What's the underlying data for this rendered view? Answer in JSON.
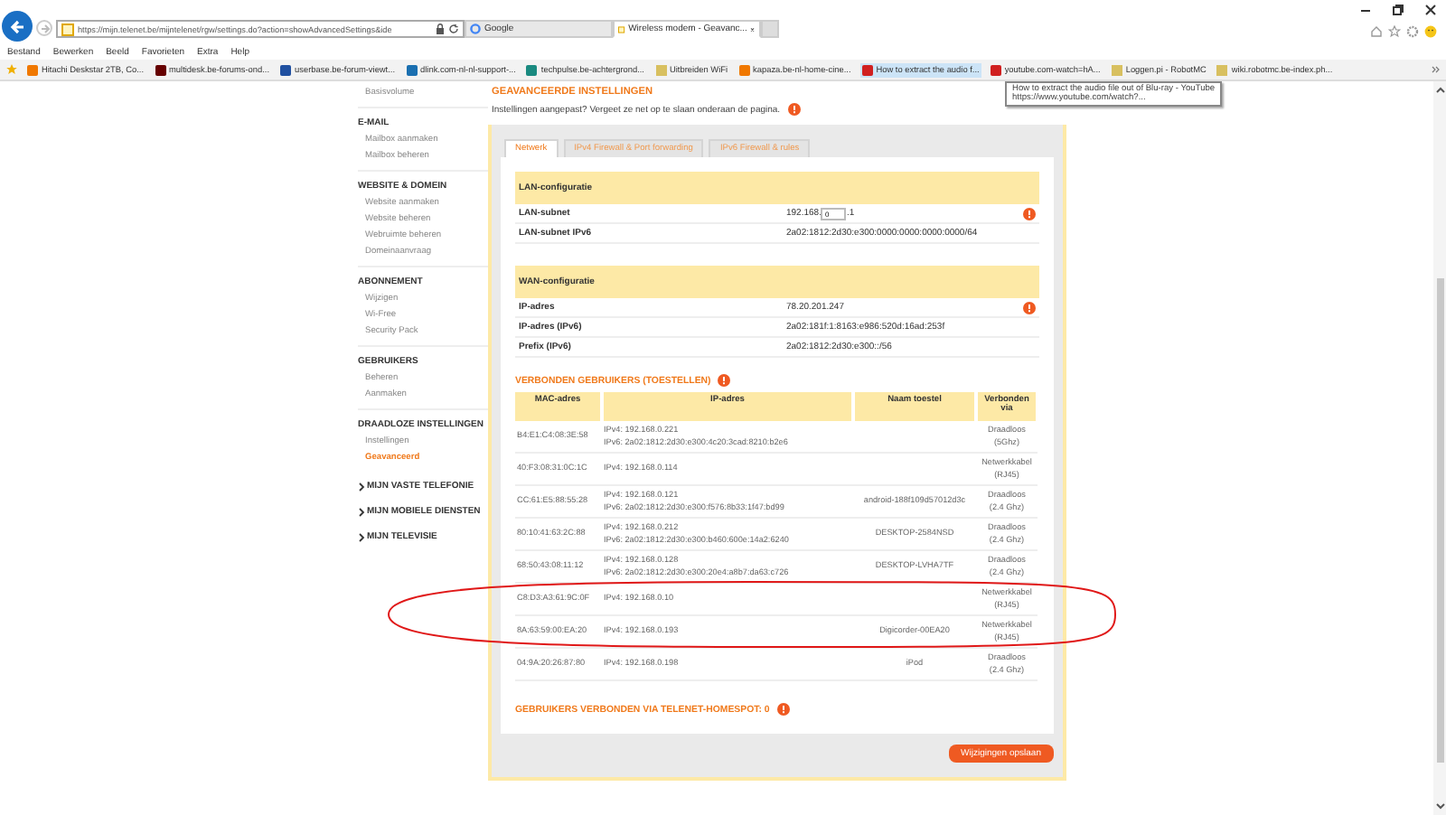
{
  "browser": {
    "address": "https://mijn.telenet.be/mijntelenet/rgw/settings.do?action=showAdvancedSettings&ide",
    "tabs": [
      {
        "label": "Google",
        "selected": false
      },
      {
        "label": "Wireless modem - Geavanc...",
        "selected": true
      }
    ],
    "menu": [
      "Bestand",
      "Bewerken",
      "Beeld",
      "Favorieten",
      "Extra",
      "Help"
    ],
    "favorites": [
      {
        "label": "Hitachi Deskstar 2TB, Co...",
        "kind": "k",
        "selected": false
      },
      {
        "label": "multidesk.be-forums-ond...",
        "kind": "dark",
        "selected": false
      },
      {
        "label": "userbase.be-forum-viewt...",
        "kind": "blue",
        "selected": false
      },
      {
        "label": "dlink.com-nl-nl-support-...",
        "kind": "d",
        "selected": false
      },
      {
        "label": "techpulse.be-achtergrond...",
        "kind": "teal",
        "selected": false
      },
      {
        "label": "Uitbreiden WiFi",
        "kind": "page",
        "selected": false
      },
      {
        "label": "kapaza.be-nl-home-cine...",
        "kind": "k",
        "selected": false
      },
      {
        "label": "How to extract the audio f...",
        "kind": "yt",
        "selected": true
      },
      {
        "label": "youtube.com-watch=hA...",
        "kind": "yt",
        "selected": false
      },
      {
        "label": "Loggen.pi - RobotMC",
        "kind": "page",
        "selected": false
      },
      {
        "label": "wiki.robotmc.be-index.ph...",
        "kind": "page",
        "selected": false
      }
    ],
    "tooltip": {
      "title": "How to extract the audio file out of Blu-ray - YouTube",
      "url": "https://www.youtube.com/watch?..."
    }
  },
  "sidebar": {
    "top_item": "Basisvolume",
    "groups": [
      {
        "title": "E-MAIL",
        "items": [
          {
            "label": "Mailbox aanmaken",
            "selected": false
          },
          {
            "label": "Mailbox beheren",
            "selected": false
          }
        ]
      },
      {
        "title": "WEBSITE & DOMEIN",
        "items": [
          {
            "label": "Website aanmaken",
            "selected": false
          },
          {
            "label": "Website beheren",
            "selected": false
          },
          {
            "label": "Webruimte beheren",
            "selected": false
          },
          {
            "label": "Domeinaanvraag",
            "selected": false
          }
        ]
      },
      {
        "title": "ABONNEMENT",
        "items": [
          {
            "label": "Wijzigen",
            "selected": false
          },
          {
            "label": "Wi-Free",
            "selected": false
          },
          {
            "label": "Security Pack",
            "selected": false
          }
        ]
      },
      {
        "title": "GEBRUIKERS",
        "items": [
          {
            "label": "Beheren",
            "selected": false
          },
          {
            "label": "Aanmaken",
            "selected": false
          }
        ]
      },
      {
        "title": "DRAADLOZE INSTELLINGEN",
        "items": [
          {
            "label": "Instellingen",
            "selected": false
          },
          {
            "label": "Geavanceerd",
            "selected": true
          }
        ]
      }
    ],
    "sections": [
      {
        "label": "MIJN VASTE TELEFONIE",
        "expanded": false
      },
      {
        "label": "MIJN MOBIELE DIENSTEN",
        "expanded": false
      },
      {
        "label": "MIJN TELEVISIE",
        "expanded": false
      }
    ]
  },
  "main": {
    "title": "GEAVANCEERDE INSTELLINGEN",
    "subtitle": "Instellingen aangepast? Vergeet ze net op te slaan onderaan de pagina.",
    "tabs": [
      {
        "label": "Netwerk",
        "selected": true
      },
      {
        "label": "IPv4 Firewall & Port forwarding",
        "selected": false
      },
      {
        "label": "IPv6 Firewall & rules",
        "selected": false
      }
    ],
    "lan": {
      "title": "LAN-configuratie",
      "subnet_label": "LAN-subnet",
      "subnet_prefix": "192.168.",
      "subnet_value": "0",
      "subnet_suffix": ".1",
      "ipv6_label": "LAN-subnet IPv6",
      "ipv6_value": "2a02:1812:2d30:e300:0000:0000:0000:0000/64"
    },
    "wan": {
      "title": "WAN-configuratie",
      "rows": [
        {
          "label": "IP-adres",
          "value": "78.20.201.247",
          "info": true
        },
        {
          "label": "IP-adres (IPv6)",
          "value": "2a02:181f:1:8163:e986:520d:16ad:253f",
          "info": false
        },
        {
          "label": "Prefix (IPv6)",
          "value": "2a02:1812:2d30:e300::/56",
          "info": false
        }
      ]
    },
    "devices": {
      "title": "VERBONDEN GEBRUIKERS (TOESTELLEN)",
      "columns": [
        "MAC-adres",
        "IP-adres",
        "Naam toestel",
        "Verbonden via"
      ],
      "rows": [
        {
          "mac": "B4:E1:C4:08:3E:58",
          "ip": [
            "IPv4: 192.168.0.221",
            "IPv6: 2a02:1812:2d30:e300:4c20:3cad:8210:b2e6"
          ],
          "name": "",
          "via": [
            "Draadloos",
            "(5Ghz)"
          ]
        },
        {
          "mac": "40:F3:08:31:0C:1C",
          "ip": [
            "IPv4: 192.168.0.114"
          ],
          "name": "",
          "via": [
            "Netwerkkabel",
            "(RJ45)"
          ]
        },
        {
          "mac": "CC:61:E5:88:55:28",
          "ip": [
            "IPv4: 192.168.0.121",
            "IPv6: 2a02:1812:2d30:e300:f576:8b33:1f47:bd99"
          ],
          "name": "android-188f109d57012d3c",
          "via": [
            "Draadloos",
            "(2.4 Ghz)"
          ]
        },
        {
          "mac": "80:10:41:63:2C:88",
          "ip": [
            "IPv4: 192.168.0.212",
            "IPv6: 2a02:1812:2d30:e300:b460:600e:14a2:6240"
          ],
          "name": "DESKTOP-2584NSD",
          "via": [
            "Draadloos",
            "(2.4 Ghz)"
          ]
        },
        {
          "mac": "68:50:43:08:11:12",
          "ip": [
            "IPv4: 192.168.0.128",
            "IPv6: 2a02:1812:2d30:e300:20e4:a8b7:da63:c726"
          ],
          "name": "DESKTOP-LVHA7TF",
          "via": [
            "Draadloos",
            "(2.4 Ghz)"
          ]
        },
        {
          "mac": "C8:D3:A3:61:9C:0F",
          "ip": [
            "IPv4: 192.168.0.10"
          ],
          "name": "",
          "via": [
            "Netwerkkabel",
            "(RJ45)"
          ]
        },
        {
          "mac": "8A:63:59:00:EA:20",
          "ip": [
            "IPv4: 192.168.0.193"
          ],
          "name": "Digicorder-00EA20",
          "via": [
            "Netwerkkabel",
            "(RJ45)"
          ]
        },
        {
          "mac": "04:9A:20:26:87:80",
          "ip": [
            "IPv4: 192.168.0.198"
          ],
          "name": "iPod",
          "via": [
            "Draadloos",
            "(2.4 Ghz)"
          ]
        }
      ]
    },
    "homespot": "GEBRUIKERS VERBONDEN VIA TELENET-HOMESPOT: 0",
    "save_button": "Wijzigingen opslaan"
  }
}
